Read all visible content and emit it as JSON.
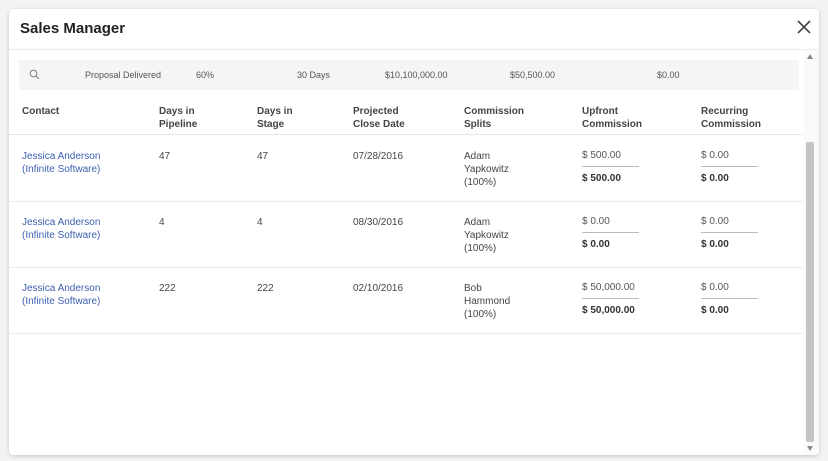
{
  "modal": {
    "title": "Sales Manager"
  },
  "summary": {
    "stage": "Proposal Delivered",
    "probability": "60%",
    "days": "30 Days",
    "pipeline_value": "$10,100,000.00",
    "commission": "$50,500.00",
    "recurring": "$0.00"
  },
  "columns": [
    "Contact",
    "Days in Pipeline",
    "Days in Stage",
    "Projected Close Date",
    "Commission Splits",
    "Upfront Commission",
    "Recurring Commission"
  ],
  "rows": [
    {
      "contact_name": "Jessica Anderson",
      "contact_company": "(Infinite Software)",
      "days_pipeline": "47",
      "days_stage": "47",
      "close_date": "07/28/2016",
      "split_first": "Adam",
      "split_last": "Yapkowitz",
      "split_pct": "(100%)",
      "upfront_input": "$ 500.00",
      "upfront_total": "$ 500.00",
      "recurring_input": "$ 0.00",
      "recurring_total": "$ 0.00"
    },
    {
      "contact_name": "Jessica Anderson",
      "contact_company": "(Infinite Software)",
      "days_pipeline": "4",
      "days_stage": "4",
      "close_date": "08/30/2016",
      "split_first": "Adam",
      "split_last": "Yapkowitz",
      "split_pct": "(100%)",
      "upfront_input": "$ 0.00",
      "upfront_total": "$ 0.00",
      "recurring_input": "$ 0.00",
      "recurring_total": "$ 0.00"
    },
    {
      "contact_name": "Jessica Anderson",
      "contact_company": "(Infinite Software)",
      "days_pipeline": "222",
      "days_stage": "222",
      "close_date": "02/10/2016",
      "split_first": "Bob",
      "split_last": "Hammond",
      "split_pct": "(100%)",
      "upfront_input": "$ 50,000.00",
      "upfront_total": "$ 50,000.00",
      "recurring_input": "$ 0.00",
      "recurring_total": "$ 0.00"
    }
  ],
  "icons": {
    "search": "search-icon",
    "close": "close-icon"
  },
  "colors": {
    "link": "#3b5fb0",
    "summary_bg": "#f5f5f5",
    "scroll_thumb": "#c4c4c4"
  }
}
